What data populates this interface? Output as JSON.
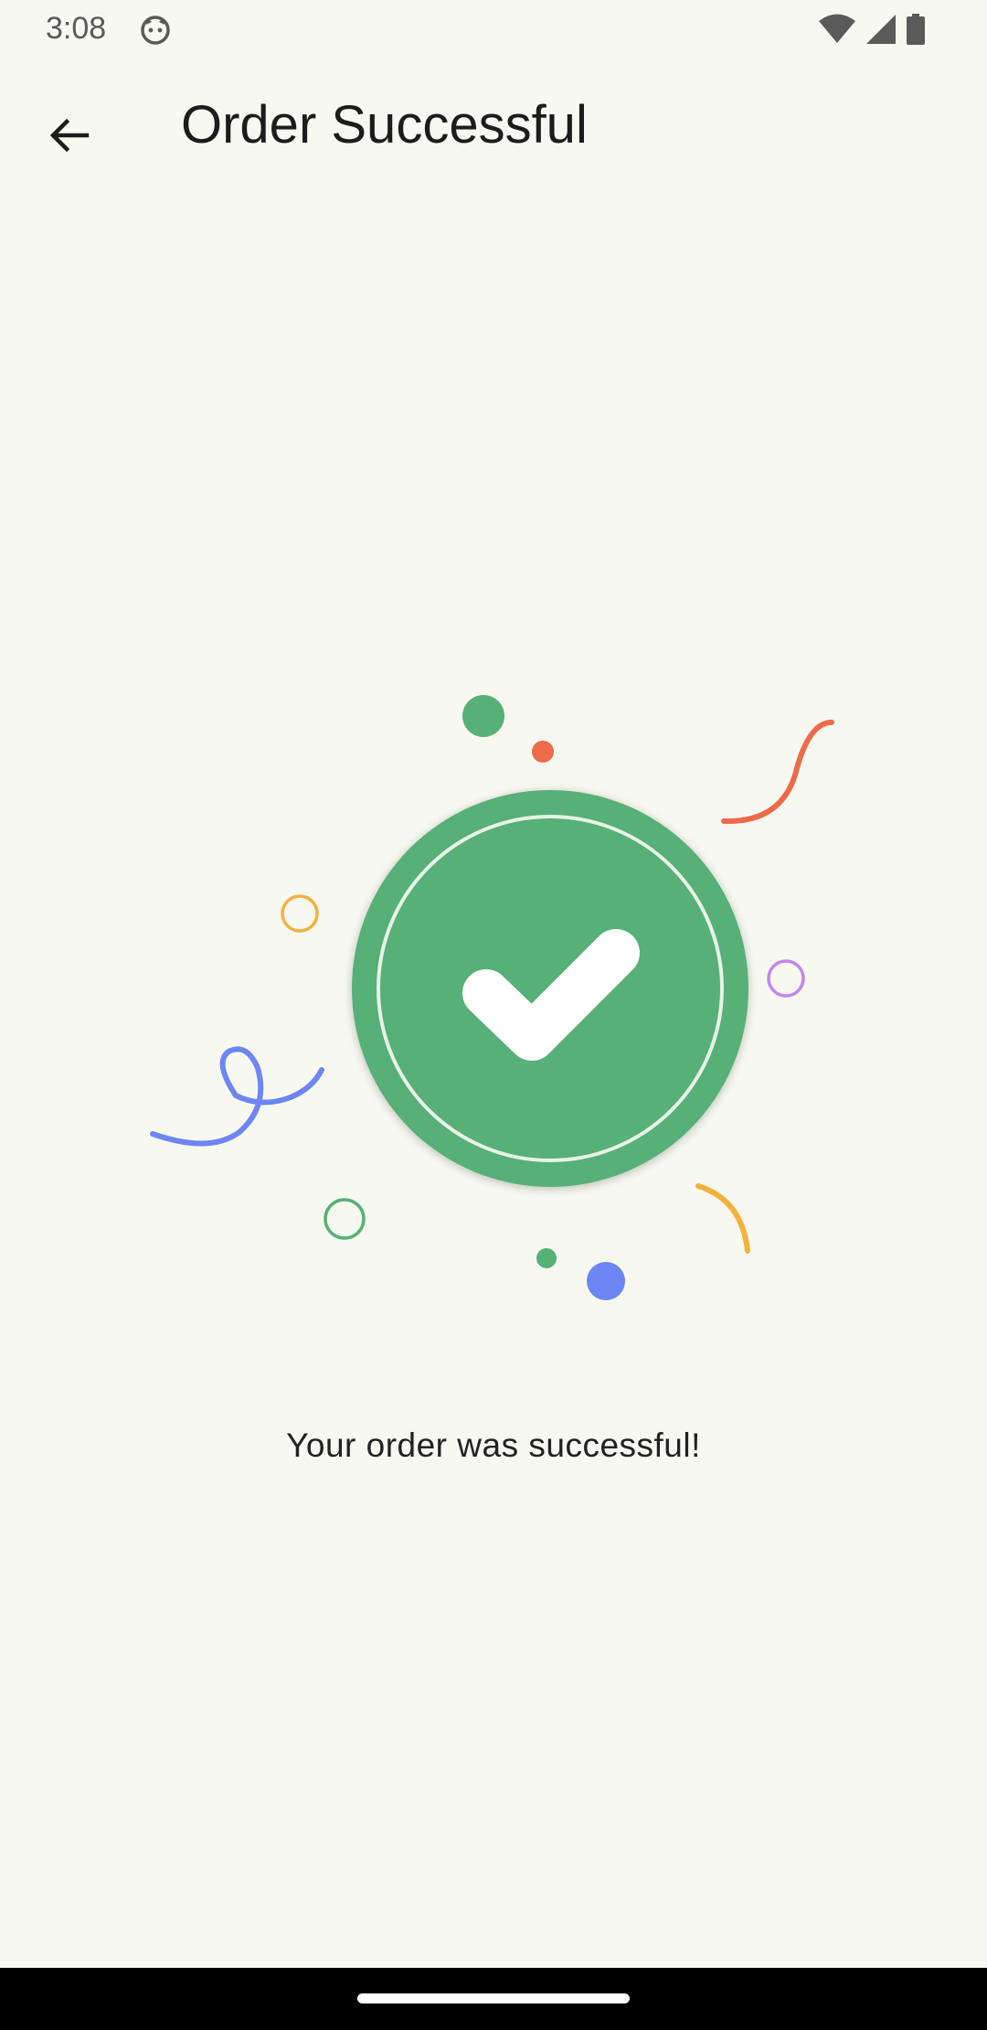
{
  "status_bar": {
    "time": "3:08",
    "icons": [
      "face-icon",
      "wifi-icon",
      "signal-icon",
      "battery-icon"
    ]
  },
  "app_bar": {
    "back_icon": "arrow-back-icon",
    "title": "Order Successful"
  },
  "illustration": {
    "icon": "check-icon",
    "accent_color": "#56b077",
    "confetti_colors": [
      "#56b077",
      "#ef6a4a",
      "#f5b13d",
      "#c486f0",
      "#6e85f5"
    ]
  },
  "message": "Your order was successful!",
  "colors": {
    "background": "#f7f9f0",
    "success_green": "#56b077",
    "nav_bar": "#000000"
  }
}
